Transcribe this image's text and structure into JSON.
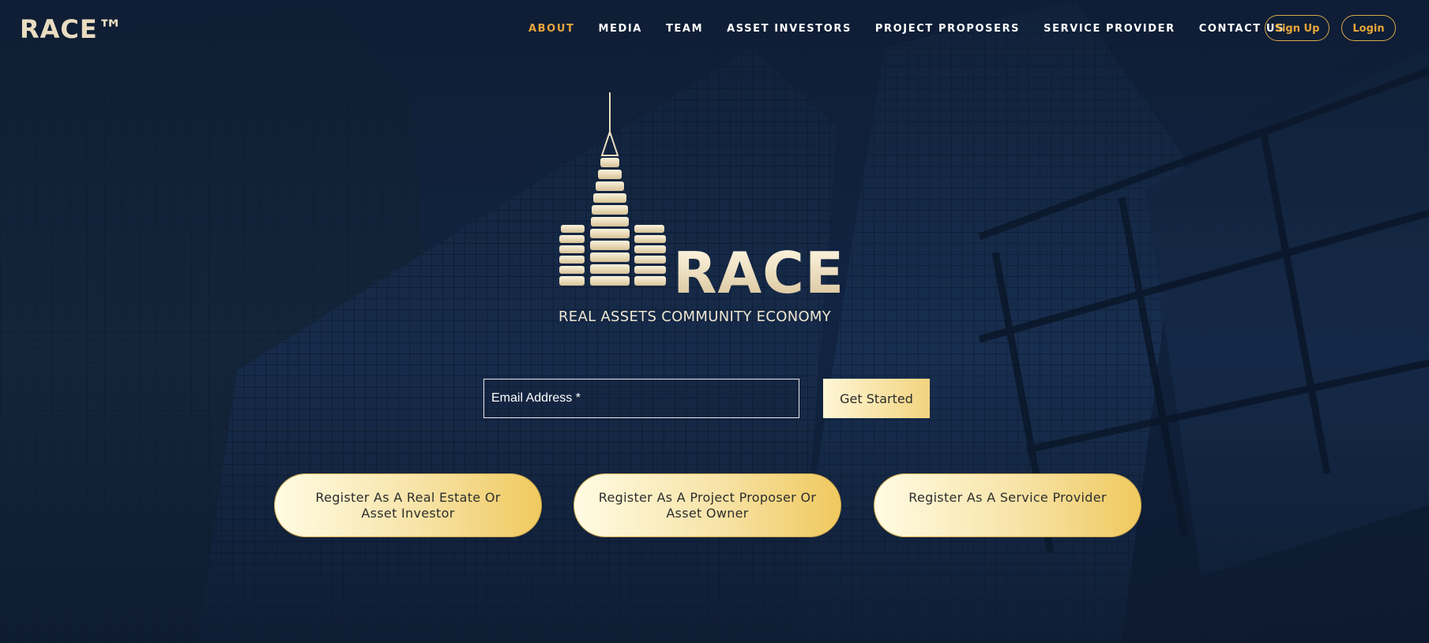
{
  "brand": {
    "logo_text": "RACE™"
  },
  "nav": {
    "items": [
      {
        "label": "ABOUT",
        "active": true
      },
      {
        "label": "MEDIA",
        "active": false
      },
      {
        "label": "TEAM",
        "active": false
      },
      {
        "label": "ASSET INVESTORS",
        "active": false
      },
      {
        "label": "PROJECT PROPOSERS",
        "active": false
      },
      {
        "label": "SERVICE PROVIDER",
        "active": false
      },
      {
        "label": "CONTACT US",
        "active": false
      }
    ],
    "signup_label": "Sign Up",
    "login_label": "Login"
  },
  "hero": {
    "wordmark": "RACE",
    "tagline": "REAL ASSETS COMMUNITY ECONOMY",
    "tower_mark_text": "RACE"
  },
  "email_form": {
    "placeholder": "Email Address *",
    "button_label": "Get Started"
  },
  "register": {
    "investor_label": "Register As A Real Estate Or Asset Investor",
    "proposer_label": "Register As A Project Proposer Or Asset Owner",
    "provider_label": "Register As A Service Provider"
  },
  "colors": {
    "accent": "#e8a63a",
    "background": "#0f1d33",
    "button_gradient_start": "#fffbe3",
    "button_gradient_end": "#f0c95e"
  }
}
